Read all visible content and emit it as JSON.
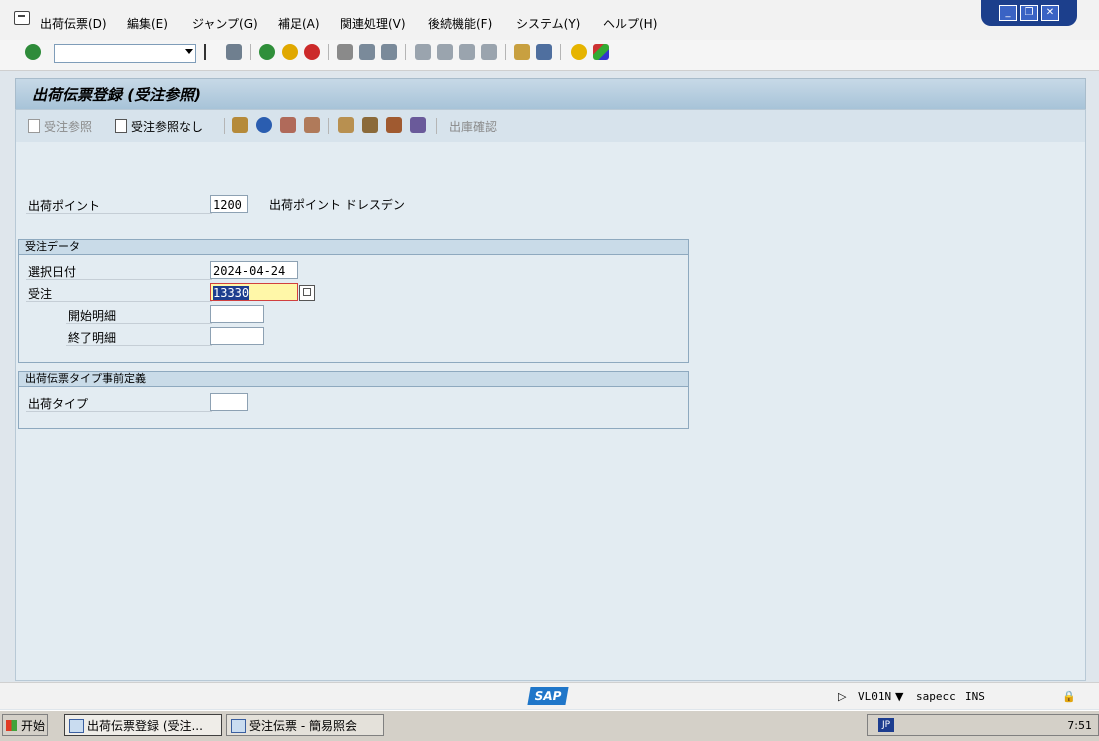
{
  "menu": {
    "items": [
      "出荷伝票(D)",
      "編集(E)",
      "ジャンプ(G)",
      "補足(A)",
      "関連処理(V)",
      "後続機能(F)",
      "システム(Y)",
      "ヘルプ(H)"
    ]
  },
  "window_controls": {
    "minimize": "_",
    "restore": "❐",
    "close": "✕"
  },
  "toolbar": {
    "icons": [
      "enter-icon",
      "back-icon",
      "save-icon",
      "back-nav-icon",
      "exit-icon",
      "cancel-icon",
      "print-icon",
      "find-icon",
      "find-next-icon",
      "first-page-icon",
      "prev-page-icon",
      "next-page-icon",
      "last-page-icon",
      "create-session-icon",
      "shortcut-icon",
      "help-icon",
      "layout-icon"
    ]
  },
  "screen": {
    "title": "出荷伝票登録 (受注参照)",
    "app_buttons": {
      "with_order": "受注参照",
      "without_order": "受注参照なし",
      "outbound_confirm": "出庫確認"
    }
  },
  "form": {
    "shipping_point": {
      "label": "出荷ポイント",
      "value": "1200",
      "desc": "出荷ポイント ドレスデン"
    },
    "order_data": {
      "title": "受注データ",
      "selection_date": {
        "label": "選択日付",
        "value": "2024-04-24"
      },
      "order": {
        "label": "受注",
        "value": "13330"
      },
      "from_item": {
        "label": "開始明細",
        "value": ""
      },
      "to_item": {
        "label": "終了明細",
        "value": ""
      }
    },
    "delivery_type_default": {
      "title": "出荷伝票タイプ事前定義",
      "delivery_type": {
        "label": "出荷タイプ",
        "value": ""
      }
    }
  },
  "status": {
    "transaction": "VL01N",
    "system": "sapecc",
    "mode": "INS",
    "logo": "SAP"
  },
  "taskbar": {
    "start": "开始",
    "tasks": [
      "出荷伝票登録 (受注...",
      "受注伝票 - 簡易照会"
    ],
    "lang": "JP",
    "clock": "7:51"
  },
  "colors": {
    "title_bg": "#b8cfe0",
    "content_bg": "#e3ecf2",
    "focus_field": "#fff7a8",
    "sap_blue": "#1f76c9"
  }
}
